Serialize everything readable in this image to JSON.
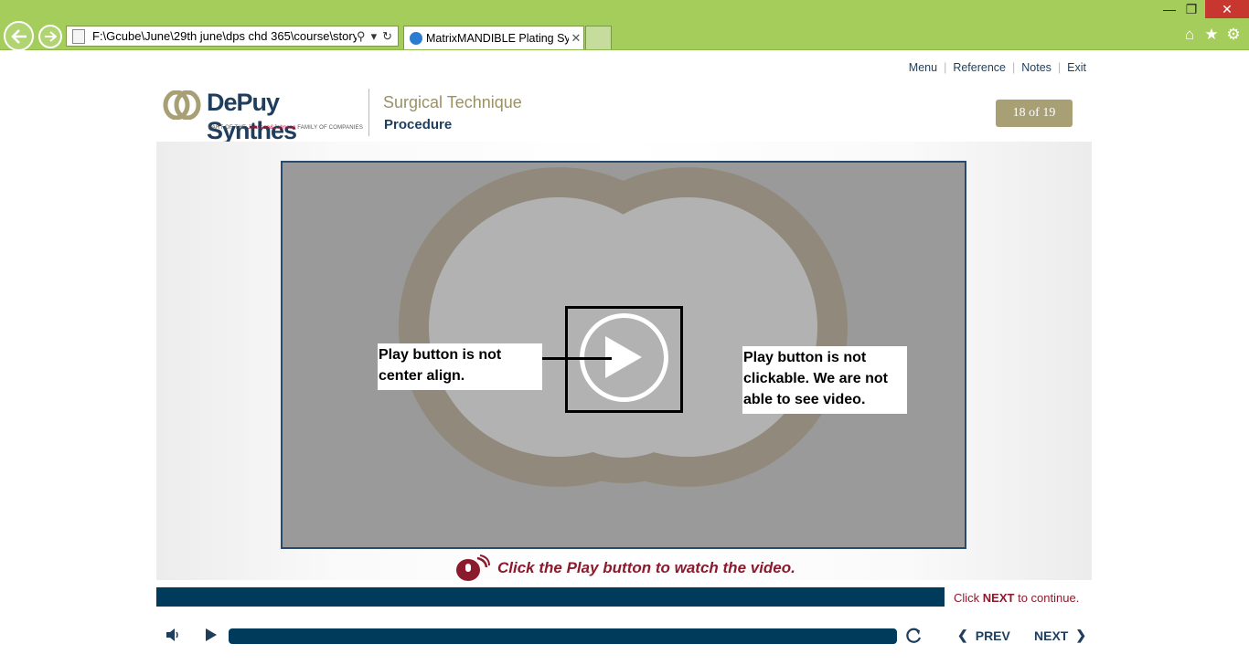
{
  "browser": {
    "url": "F:\\Gcube\\June\\29th june\\dps chd 365\\course\\story.ht",
    "tab_title": "MatrixMANDIBLE Plating Sy...",
    "tab_close": "✕",
    "search_glyph": "⚲",
    "dropdown_glyph": "▾",
    "refresh_glyph": "↻",
    "window_min": "—",
    "window_restore": "❐",
    "window_close": "✕",
    "home_glyph": "⌂",
    "star_glyph": "★",
    "gear_glyph": "⚙"
  },
  "course_nav": {
    "menu": "Menu",
    "reference": "Reference",
    "notes": "Notes",
    "exit": "Exit",
    "separator": "|"
  },
  "header": {
    "brand": "DePuy Synthes",
    "brand_tagline_prefix": "PART OF THE",
    "brand_tagline_jj": "Johnson&Johnson",
    "brand_tagline_suffix": "FAMILY OF COMPANIES",
    "title": "Surgical Technique",
    "subtitle": "Procedure",
    "page_counter": "18 of 19"
  },
  "annotations": {
    "left_note": "Play button is not center align.",
    "right_note": "Play button is not clickable. We are not able to see video."
  },
  "instruction": "Click the Play button to watch the video.",
  "continue_hint": {
    "prefix": "Click",
    "keyword": "NEXT",
    "suffix": "to continue."
  },
  "player": {
    "prev_label": "PREV",
    "next_label": "NEXT",
    "prev_glyph": "❮",
    "next_glyph": "❯"
  },
  "colors": {
    "browser_chrome": "#a4cd5b",
    "brand_navy": "#1f3d5d",
    "brand_gold": "#9a9166",
    "progress": "#003b5c",
    "accent_red": "#8b1a2d"
  }
}
